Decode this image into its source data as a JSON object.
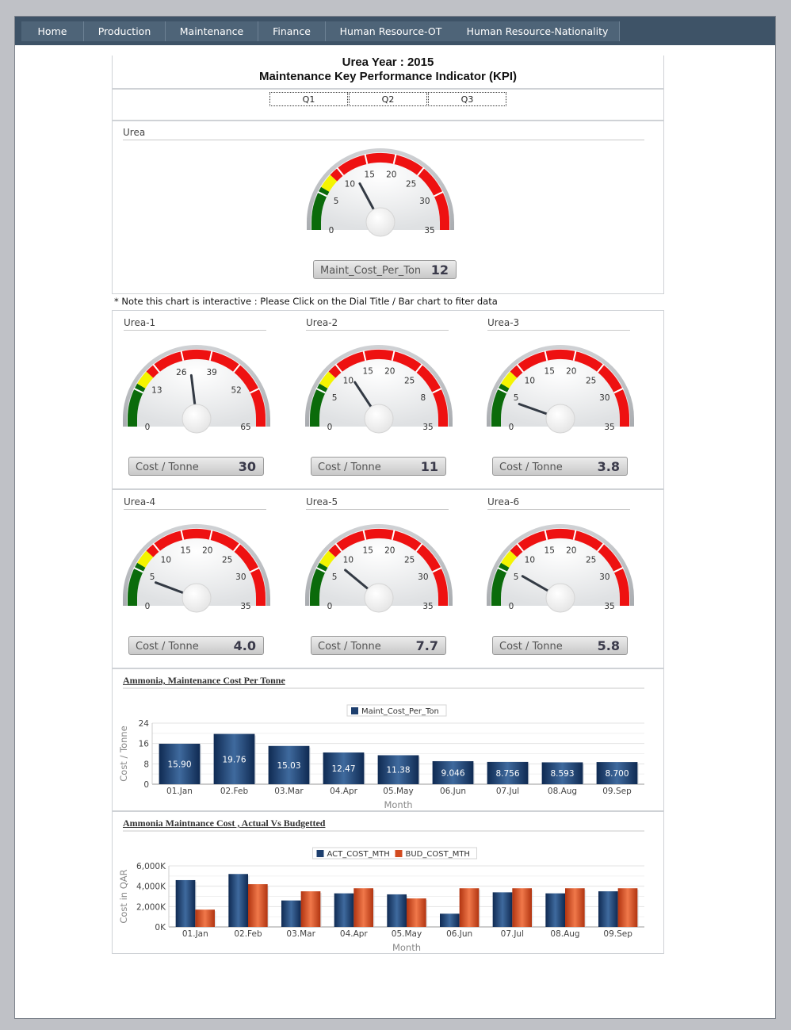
{
  "nav": [
    "Home",
    "Production",
    "Maintenance",
    "Finance",
    "Human Resource-OT",
    "Human Resource-Nationality"
  ],
  "header": {
    "title1": "Urea Year : 2015",
    "title2": "Maintenance Key Performance Indicator (KPI)"
  },
  "quarters": [
    "Q1",
    "Q2",
    "Q3"
  ],
  "note": "* Note this chart is interactive : Please Click on the Dial Title / Bar chart to fiter data",
  "colors": {
    "good": "#0b6b0b",
    "warn": "#f4f400",
    "bad": "#ee1111",
    "bar_act": "#1d3f6e",
    "bar_bud": "#d24a1f"
  },
  "main_gauge": {
    "section": "Urea",
    "label": "Maint_Cost_Per_Ton",
    "value": 12,
    "display": "12",
    "max": 35,
    "ticks": [
      "0",
      "5",
      "10",
      "15",
      "20",
      "25",
      "30",
      "35"
    ]
  },
  "gauges": [
    {
      "section": "Urea-1",
      "label": "Cost / Tonne",
      "value": 30,
      "display": "30",
      "max": 65,
      "ticks": [
        "0",
        "13",
        "26",
        "39",
        "52",
        "65"
      ]
    },
    {
      "section": "Urea-2",
      "label": "Cost / Tonne",
      "value": 11,
      "display": "11",
      "max": 35,
      "ticks": [
        "0",
        "5",
        "10",
        "15",
        "20",
        "25",
        "8",
        "35"
      ]
    },
    {
      "section": "Urea-3",
      "label": "Cost / Tonne",
      "value": 3.8,
      "display": "3.8",
      "max": 35,
      "ticks": [
        "0",
        "5",
        "10",
        "15",
        "20",
        "25",
        "30",
        "35"
      ]
    },
    {
      "section": "Urea-4",
      "label": "Cost / Tonne",
      "value": 4.0,
      "display": "4.0",
      "max": 35,
      "ticks": [
        "0",
        "5",
        "10",
        "15",
        "20",
        "25",
        "30",
        "35"
      ]
    },
    {
      "section": "Urea-5",
      "label": "Cost / Tonne",
      "value": 7.7,
      "display": "7.7",
      "max": 35,
      "ticks": [
        "0",
        "5",
        "10",
        "15",
        "20",
        "25",
        "30",
        "35"
      ]
    },
    {
      "section": "Urea-6",
      "label": "Cost / Tonne",
      "value": 5.8,
      "display": "5.8",
      "max": 35,
      "ticks": [
        "0",
        "5",
        "10",
        "15",
        "20",
        "25",
        "30",
        "35"
      ]
    }
  ],
  "chart_data": [
    {
      "type": "bar",
      "title": "Ammonia, Maintenance Cost Per Tonne",
      "xlabel": "Month",
      "ylabel": "Cost / Tonne",
      "ylim": [
        0,
        24
      ],
      "yticks": [
        "0",
        "8",
        "16",
        "24"
      ],
      "categories": [
        "01.Jan",
        "02.Feb",
        "03.Mar",
        "04.Apr",
        "05.May",
        "06.Jun",
        "07.Jul",
        "08.Aug",
        "09.Sep"
      ],
      "series": [
        {
          "name": "Maint_Cost_Per_Ton",
          "values": [
            15.9,
            19.76,
            15.03,
            12.47,
            11.38,
            9.046,
            8.756,
            8.593,
            8.7
          ],
          "labels": [
            "15.90",
            "19.76",
            "15.03",
            "12.47",
            "11.38",
            "9.046",
            "8.756",
            "8.593",
            "8.700"
          ]
        }
      ],
      "legend": "top-center",
      "grid": true
    },
    {
      "type": "bar",
      "title": "Ammonia Maintnance Cost , Actual Vs Budgetted",
      "xlabel": "Month",
      "ylabel": "Cost in QAR",
      "ylim": [
        0,
        6000
      ],
      "yticks": [
        "0K",
        "2,000K",
        "4,000K",
        "6,000K"
      ],
      "categories": [
        "01.Jan",
        "02.Feb",
        "03.Mar",
        "04.Apr",
        "05.May",
        "06.Jun",
        "07.Jul",
        "08.Aug",
        "09.Sep"
      ],
      "series": [
        {
          "name": "ACT_COST_MTH",
          "values": [
            4600,
            5200,
            2600,
            3300,
            3200,
            1300,
            3400,
            3300,
            3500
          ]
        },
        {
          "name": "BUD_COST_MTH",
          "values": [
            1700,
            4200,
            3500,
            3800,
            2800,
            3800,
            3800,
            3800,
            3800
          ]
        }
      ],
      "legend": "top-center",
      "grid": true
    }
  ]
}
